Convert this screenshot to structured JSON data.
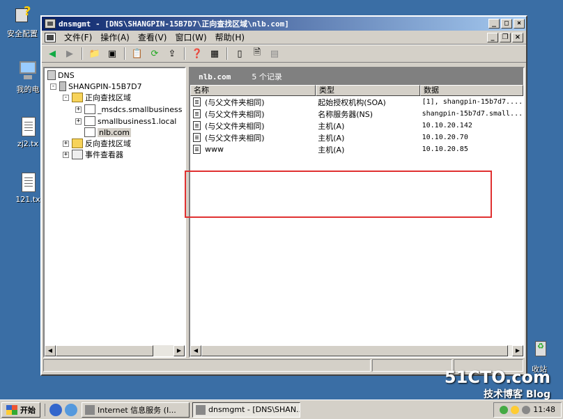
{
  "desktop": {
    "icons": [
      {
        "label": "安全配置"
      },
      {
        "label": "我的电"
      },
      {
        "label": "zj2.tx"
      },
      {
        "label": "121.tx"
      },
      {
        "label": "收站"
      }
    ]
  },
  "window": {
    "title": "dnsmgmt - [DNS\\SHANGPIN-15B7D7\\正向查找区域\\nlb.com]",
    "menus": [
      "文件(F)",
      "操作(A)",
      "查看(V)",
      "窗口(W)",
      "帮助(H)"
    ]
  },
  "tree": {
    "items": [
      {
        "label": "DNS",
        "expander": ""
      },
      {
        "label": "SHANGPIN-15B7D7",
        "expander": "-"
      },
      {
        "label": "正向查找区域",
        "expander": "-"
      },
      {
        "label": "_msdcs.smallbusiness",
        "expander": "+"
      },
      {
        "label": "smallbusiness1.local",
        "expander": "+"
      },
      {
        "label": "nlb.com",
        "expander": ""
      },
      {
        "label": "反向查找区域",
        "expander": "+"
      },
      {
        "label": "事件查看器",
        "expander": "+"
      }
    ]
  },
  "detail": {
    "zone": "nlb.com",
    "count": "5 个记录",
    "columns": [
      "名称",
      "类型",
      "数据"
    ],
    "rows": [
      {
        "name": "(与父文件夹相同)",
        "type": "起始授权机构(SOA)",
        "data": "[1], shangpin-15b7d7...."
      },
      {
        "name": "(与父文件夹相同)",
        "type": "名称服务器(NS)",
        "data": "shangpin-15b7d7.small..."
      },
      {
        "name": "(与父文件夹相同)",
        "type": "主机(A)",
        "data": "10.10.20.142"
      },
      {
        "name": "(与父文件夹相同)",
        "type": "主机(A)",
        "data": "10.10.20.70"
      },
      {
        "name": "www",
        "type": "主机(A)",
        "data": "10.10.20.85"
      }
    ]
  },
  "taskbar": {
    "start": "开始",
    "tasks": [
      "Internet 信息服务 (I...",
      "dnsmgmt - [DNS\\SHAN..."
    ],
    "clock": "11:48"
  },
  "watermark": {
    "main": "51CTO.com",
    "sub": "技术博客 Blog"
  },
  "colors": {
    "highlight": "#e03030",
    "desktop": "#3a6ea5",
    "titlebar": "#0a246a"
  }
}
